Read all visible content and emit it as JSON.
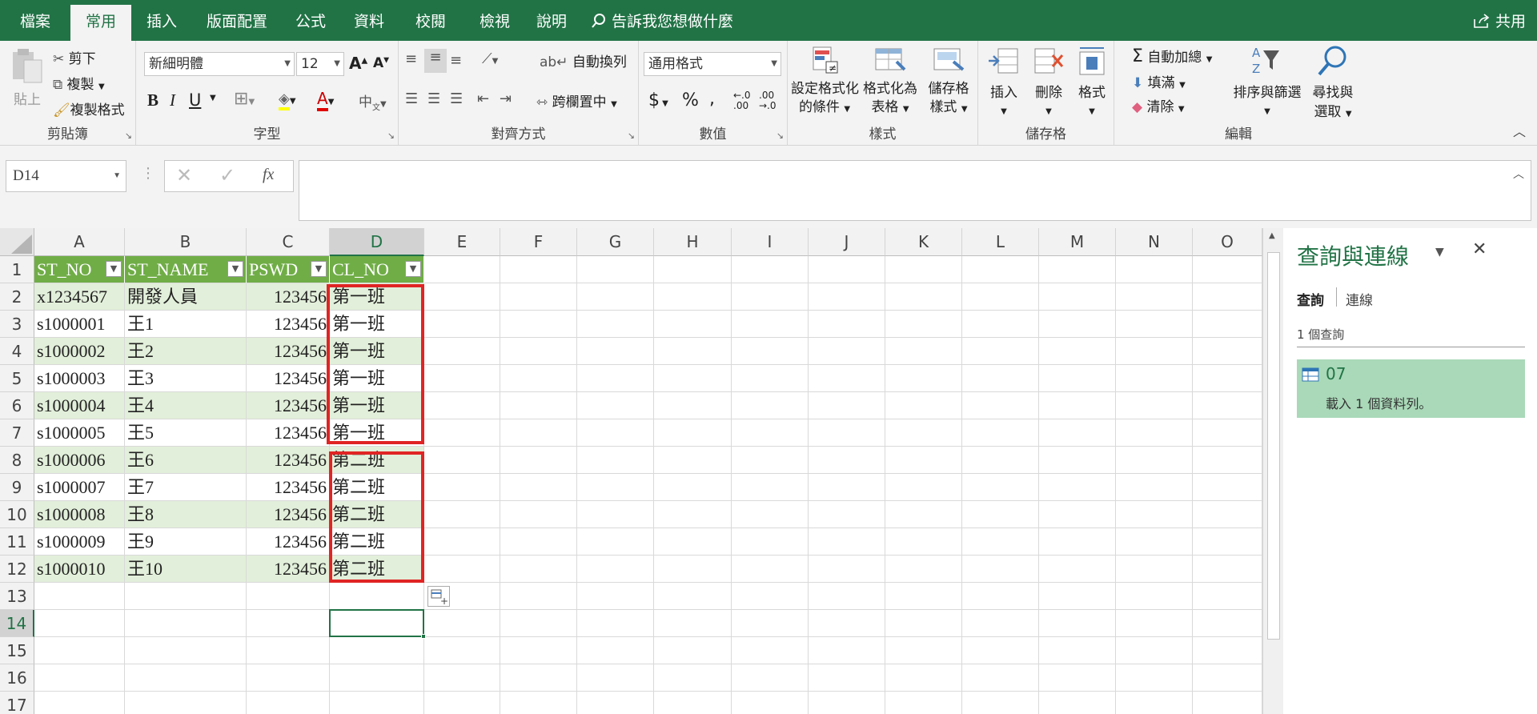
{
  "tabs": [
    "檔案",
    "常用",
    "插入",
    "版面配置",
    "公式",
    "資料",
    "校閱",
    "檢視",
    "說明"
  ],
  "tell_me": "告訴我您想做什麼",
  "share": "共用",
  "ribbon": {
    "clipboard": {
      "label": "剪貼簿",
      "paste": "貼上",
      "cut": "剪下",
      "copy": "複製",
      "format_painter": "複製格式"
    },
    "font": {
      "label": "字型",
      "name": "新細明體",
      "size": "12",
      "bold": "B",
      "italic": "I",
      "underline": "U"
    },
    "alignment": {
      "label": "對齊方式",
      "wrap": "自動換列",
      "merge": "跨欄置中"
    },
    "number": {
      "label": "數值",
      "format": "通用格式"
    },
    "styles": {
      "label": "樣式",
      "cond_a": "設定格式化",
      "cond_b": "的條件",
      "table_a": "格式化為",
      "table_b": "表格",
      "cell_a": "儲存格",
      "cell_b": "樣式"
    },
    "cells": {
      "label": "儲存格",
      "insert": "插入",
      "delete": "刪除",
      "format": "格式"
    },
    "editing": {
      "label": "編輯",
      "autosum": "自動加總",
      "fill": "填滿",
      "clear": "清除",
      "sort_a": "排序與篩選",
      "find_a": "尋找與",
      "find_b": "選取"
    }
  },
  "name_box": "D14",
  "columns": [
    "A",
    "B",
    "C",
    "D",
    "E",
    "F",
    "G",
    "H",
    "I",
    "J",
    "K",
    "L",
    "M",
    "N",
    "O"
  ],
  "rows": [
    "1",
    "2",
    "3",
    "4",
    "5",
    "6",
    "7",
    "8",
    "9",
    "10",
    "11",
    "12",
    "13",
    "14",
    "15",
    "16",
    "17"
  ],
  "table": {
    "headers": [
      "ST_NO",
      "ST_NAME",
      "PSWD",
      "CL_NO"
    ],
    "rows": [
      [
        "x1234567",
        "開發人員",
        "123456",
        "第一班"
      ],
      [
        "s1000001",
        "王1",
        "123456",
        "第一班"
      ],
      [
        "s1000002",
        "王2",
        "123456",
        "第一班"
      ],
      [
        "s1000003",
        "王3",
        "123456",
        "第一班"
      ],
      [
        "s1000004",
        "王4",
        "123456",
        "第一班"
      ],
      [
        "s1000005",
        "王5",
        "123456",
        "第一班"
      ],
      [
        "s1000006",
        "王6",
        "123456",
        "第二班"
      ],
      [
        "s1000007",
        "王7",
        "123456",
        "第二班"
      ],
      [
        "s1000008",
        "王8",
        "123456",
        "第二班"
      ],
      [
        "s1000009",
        "王9",
        "123456",
        "第二班"
      ],
      [
        "s1000010",
        "王10",
        "123456",
        "第二班"
      ]
    ]
  },
  "pane": {
    "title": "查詢與連線",
    "tab_queries": "查詢",
    "tab_connections": "連線",
    "count": "1 個查詢",
    "query_name": "07",
    "query_status": "載入 1 個資料列。"
  },
  "colors": {
    "accent": "#217346",
    "table_header": "#70ad47",
    "band": "#e2efda",
    "highlight": "#e02424"
  }
}
